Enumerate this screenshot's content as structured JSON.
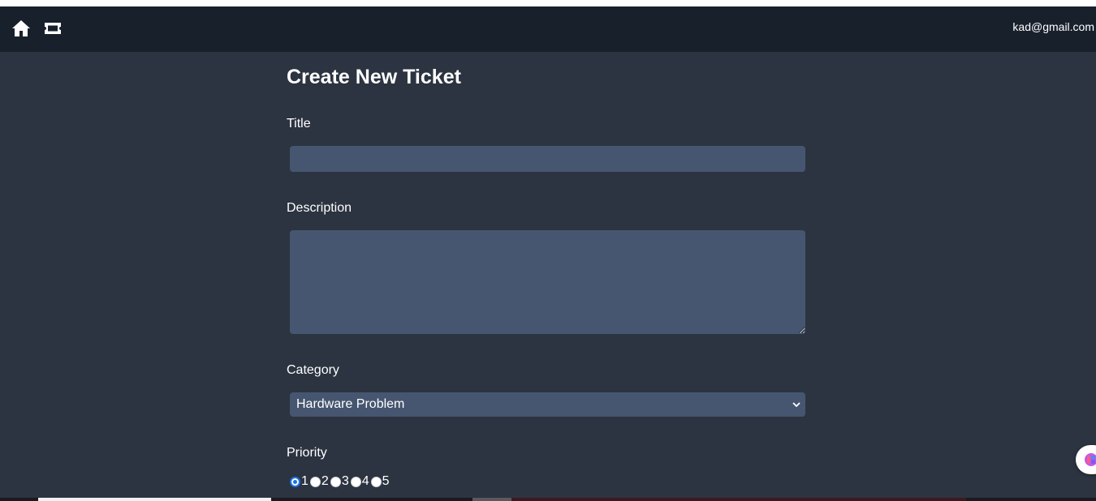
{
  "navbar": {
    "icons": [
      "home-icon",
      "ticket-icon"
    ],
    "user_email": "kad@gmail.com"
  },
  "form": {
    "title": "Create New Ticket",
    "title_field": {
      "label": "Title",
      "value": ""
    },
    "description_field": {
      "label": "Description",
      "value": ""
    },
    "category_field": {
      "label": "Category",
      "selected": "Hardware Problem"
    },
    "priority_field": {
      "label": "Priority",
      "options": [
        "1",
        "2",
        "3",
        "4",
        "5"
      ],
      "selected": "1"
    }
  },
  "colors": {
    "page_background": "#2c3441",
    "navbar_background": "#18202c",
    "input_background": "#465670",
    "radio_accent": "#1a73e8"
  }
}
